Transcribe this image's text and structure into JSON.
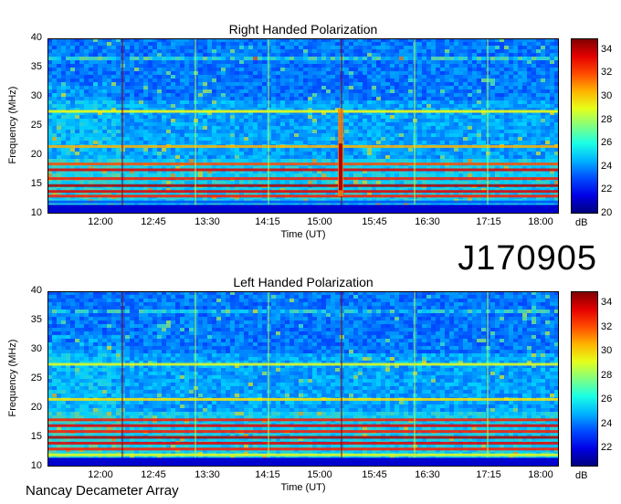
{
  "observation_id": "J170905",
  "footer": "Nancay Decameter Array",
  "colorbar_unit": "dB",
  "chart_data": [
    {
      "type": "heatmap",
      "title": "Right Handed Polarization",
      "xlabel": "Time (UT)",
      "ylabel": "Frequency (MHz)",
      "x_ticks": [
        "12:00",
        "12:45",
        "13:30",
        "14:15",
        "15:00",
        "15:45",
        "16:30",
        "17:15",
        "18:00"
      ],
      "y_ticks": [
        "10",
        "15",
        "20",
        "25",
        "30",
        "35",
        "40"
      ],
      "ylim": [
        10,
        40
      ],
      "colorbar": {
        "ticks": [
          "20",
          "22",
          "24",
          "26",
          "28",
          "30",
          "32",
          "34"
        ],
        "range": [
          20,
          35
        ],
        "label": "dB"
      }
    },
    {
      "type": "heatmap",
      "title": "Left Handed Polarization",
      "xlabel": "Time (UT)",
      "ylabel": "Frequency (MHz)",
      "x_ticks": [
        "12:00",
        "12:45",
        "13:30",
        "14:15",
        "15:00",
        "15:45",
        "16:30",
        "17:15",
        "18:00"
      ],
      "y_ticks": [
        "10",
        "15",
        "20",
        "25",
        "30",
        "35",
        "40"
      ],
      "ylim": [
        10,
        40
      ],
      "colorbar": {
        "ticks": [
          "22",
          "24",
          "26",
          "28",
          "30",
          "32",
          "34"
        ],
        "range": [
          20.5,
          35
        ],
        "label": "dB"
      }
    }
  ]
}
